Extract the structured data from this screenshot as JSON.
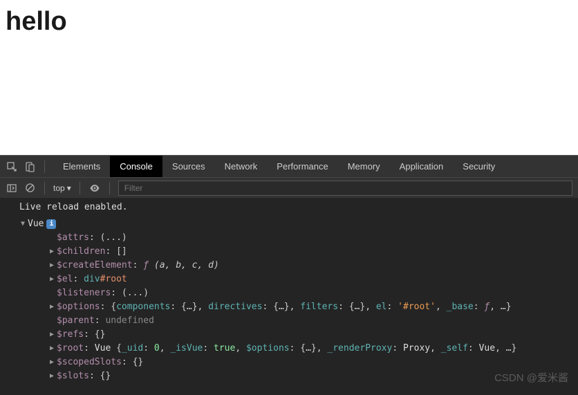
{
  "page": {
    "heading": "hello"
  },
  "tabs": {
    "elements": "Elements",
    "console": "Console",
    "sources": "Sources",
    "network": "Network",
    "performance": "Performance",
    "memory": "Memory",
    "application": "Application",
    "security": "Security"
  },
  "toolbar": {
    "context": "top",
    "filter_placeholder": "Filter"
  },
  "log": {
    "reload": "Live reload enabled."
  },
  "obj": {
    "header": "Vue",
    "attrs_key": "$attrs",
    "attrs_val": "(...)",
    "children_key": "$children",
    "children_val": "[]",
    "create_key": "$createElement",
    "create_func": "ƒ",
    "create_sig": " (a, b, c, d)",
    "el_key": "$el",
    "el_tag": "div",
    "el_id": "#root",
    "listeners_key": "$listeners",
    "listeners_val": "(...)",
    "options_key": "$options",
    "options_preview": {
      "open": "{",
      "components": "components",
      "obj1": "{…}",
      "directives": "directives",
      "obj2": "{…}",
      "filters": "filters",
      "obj3": "{…}",
      "el": "el",
      "el_val": "'#root'",
      "base": "_base",
      "base_val": "ƒ",
      "rest": ", …",
      "close": "}"
    },
    "parent_key": "$parent",
    "parent_val": "undefined",
    "refs_key": "$refs",
    "refs_val": "{}",
    "root_key": "$root",
    "root_preview": {
      "cls": "Vue ",
      "open": "{",
      "uid": "_uid",
      "uid_val": "0",
      "isvue": "_isVue",
      "isvue_val": "true",
      "opts": "$options",
      "opts_val": "{…}",
      "proxy": "_renderProxy",
      "proxy_val": "Proxy",
      "self": "_self",
      "self_val": "Vue",
      "rest": ", …",
      "close": "}"
    },
    "scoped_key": "$scopedSlots",
    "scoped_val": "{}",
    "slots_key": "$slots",
    "slots_val": "{}"
  },
  "watermark": "CSDN @爱米酱",
  "glyph": {
    "i": "i",
    "right": "▶",
    "down": "▼",
    "dd": "▾",
    "select": "⛶",
    "toggle": "⧉",
    "play": "▷",
    "ban": "⊘",
    "eye": "👁"
  }
}
